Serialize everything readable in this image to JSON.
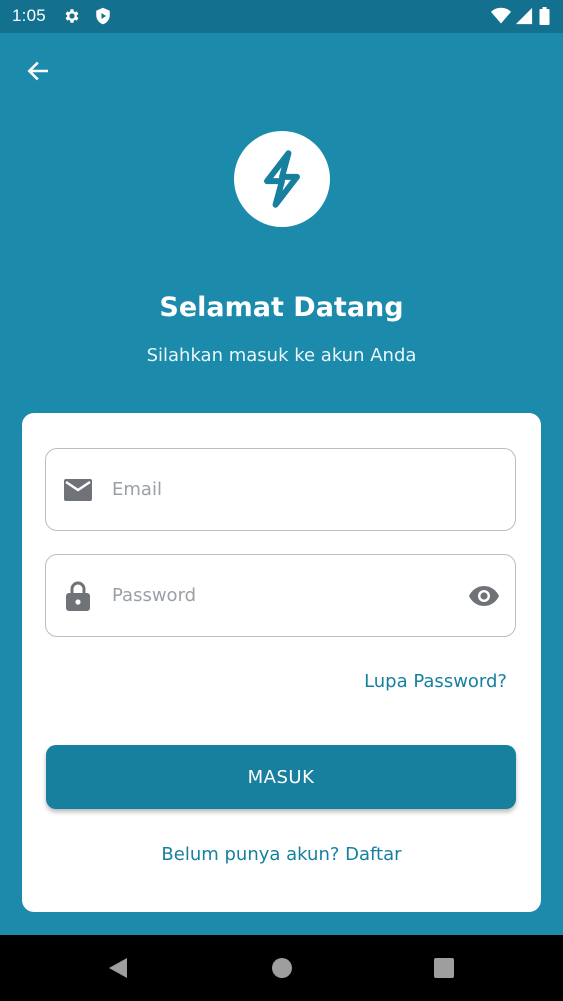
{
  "status_bar": {
    "time": "1:05",
    "icons": [
      "gear-icon",
      "shield-icon",
      "wifi-icon",
      "signal-icon",
      "battery-icon"
    ]
  },
  "header": {
    "back_icon": "arrow-left-icon",
    "logo_icon": "lightning-bolt-icon",
    "title": "Selamat Datang",
    "subtitle": "Silahkan masuk ke akun Anda"
  },
  "form": {
    "email": {
      "icon": "mail-icon",
      "placeholder": "Email",
      "value": ""
    },
    "password": {
      "icon": "lock-icon",
      "placeholder": "Password",
      "value": "",
      "toggle_icon": "eye-icon"
    },
    "forgot_link": "Lupa Password?",
    "submit_label": "MASUK",
    "register_link": "Belum punya akun? Daftar"
  },
  "colors": {
    "primary": "#1b8aab",
    "accent": "#17809e",
    "status_bar": "#13708e",
    "card": "#ffffff"
  },
  "nav_bar": {
    "icons": [
      "back-triangle-icon",
      "home-circle-icon",
      "recents-square-icon"
    ]
  }
}
